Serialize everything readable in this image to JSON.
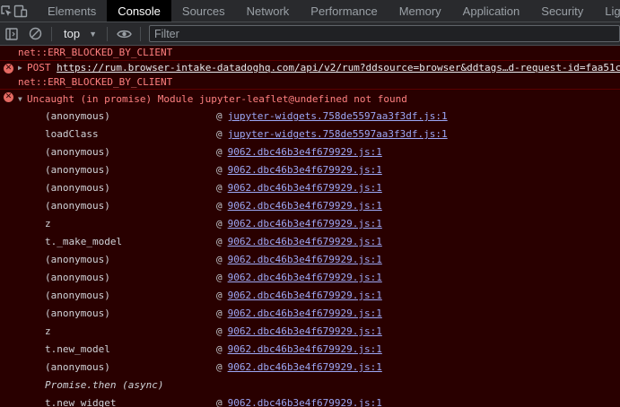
{
  "tabbar": {
    "tabs": [
      {
        "label": "Elements",
        "active": false
      },
      {
        "label": "Console",
        "active": true
      },
      {
        "label": "Sources",
        "active": false
      },
      {
        "label": "Network",
        "active": false
      },
      {
        "label": "Performance",
        "active": false
      },
      {
        "label": "Memory",
        "active": false
      },
      {
        "label": "Application",
        "active": false
      },
      {
        "label": "Security",
        "active": false
      },
      {
        "label": "Lig",
        "active": false
      }
    ]
  },
  "toolbar": {
    "context": "top",
    "filter_placeholder": "Filter"
  },
  "console": {
    "prev_error": "net::ERR_BLOCKED_BY_CLIENT",
    "post_message": {
      "method": "POST",
      "url": "https://rum.browser-intake-datadoghq.com/api/v2/rum?ddsource=browser&ddtags…d-request-id=faa51c",
      "error": "net::ERR_BLOCKED_BY_CLIENT"
    },
    "uncaught": {
      "text": "Uncaught (in promise) Module jupyter-leaflet@undefined not found",
      "frames": [
        {
          "fn": "(anonymous)",
          "src": "jupyter-widgets.758de5597aa3f3df.js:1"
        },
        {
          "fn": "loadClass",
          "src": "jupyter-widgets.758de5597aa3f3df.js:1"
        },
        {
          "fn": "(anonymous)",
          "src": "9062.dbc46b3e4f679929.js:1"
        },
        {
          "fn": "(anonymous)",
          "src": "9062.dbc46b3e4f679929.js:1"
        },
        {
          "fn": "(anonymous)",
          "src": "9062.dbc46b3e4f679929.js:1"
        },
        {
          "fn": "(anonymous)",
          "src": "9062.dbc46b3e4f679929.js:1"
        },
        {
          "fn": "z",
          "src": "9062.dbc46b3e4f679929.js:1"
        },
        {
          "fn": "t._make_model",
          "src": "9062.dbc46b3e4f679929.js:1"
        },
        {
          "fn": "(anonymous)",
          "src": "9062.dbc46b3e4f679929.js:1"
        },
        {
          "fn": "(anonymous)",
          "src": "9062.dbc46b3e4f679929.js:1"
        },
        {
          "fn": "(anonymous)",
          "src": "9062.dbc46b3e4f679929.js:1"
        },
        {
          "fn": "(anonymous)",
          "src": "9062.dbc46b3e4f679929.js:1"
        },
        {
          "fn": "z",
          "src": "9062.dbc46b3e4f679929.js:1"
        },
        {
          "fn": "t.new_model",
          "src": "9062.dbc46b3e4f679929.js:1"
        },
        {
          "fn": "(anonymous)",
          "src": "9062.dbc46b3e4f679929.js:1"
        }
      ],
      "async_label": "Promise.then (async)",
      "after_async": [
        {
          "fn": "t.new_widget",
          "src": "9062.dbc46b3e4f679929.js:1"
        }
      ]
    }
  },
  "colors": {
    "error_bg": "#290000",
    "error_text": "#ff8080",
    "link": "#9ca7f5",
    "panel": "#292a2d"
  },
  "icons": [
    "inspect-element-icon",
    "device-toolbar-icon",
    "sidebar-toggle-icon",
    "clear-console-icon",
    "dropdown-arrow-icon",
    "live-expression-eye-icon",
    "error-icon",
    "expand-triangle-icon"
  ]
}
